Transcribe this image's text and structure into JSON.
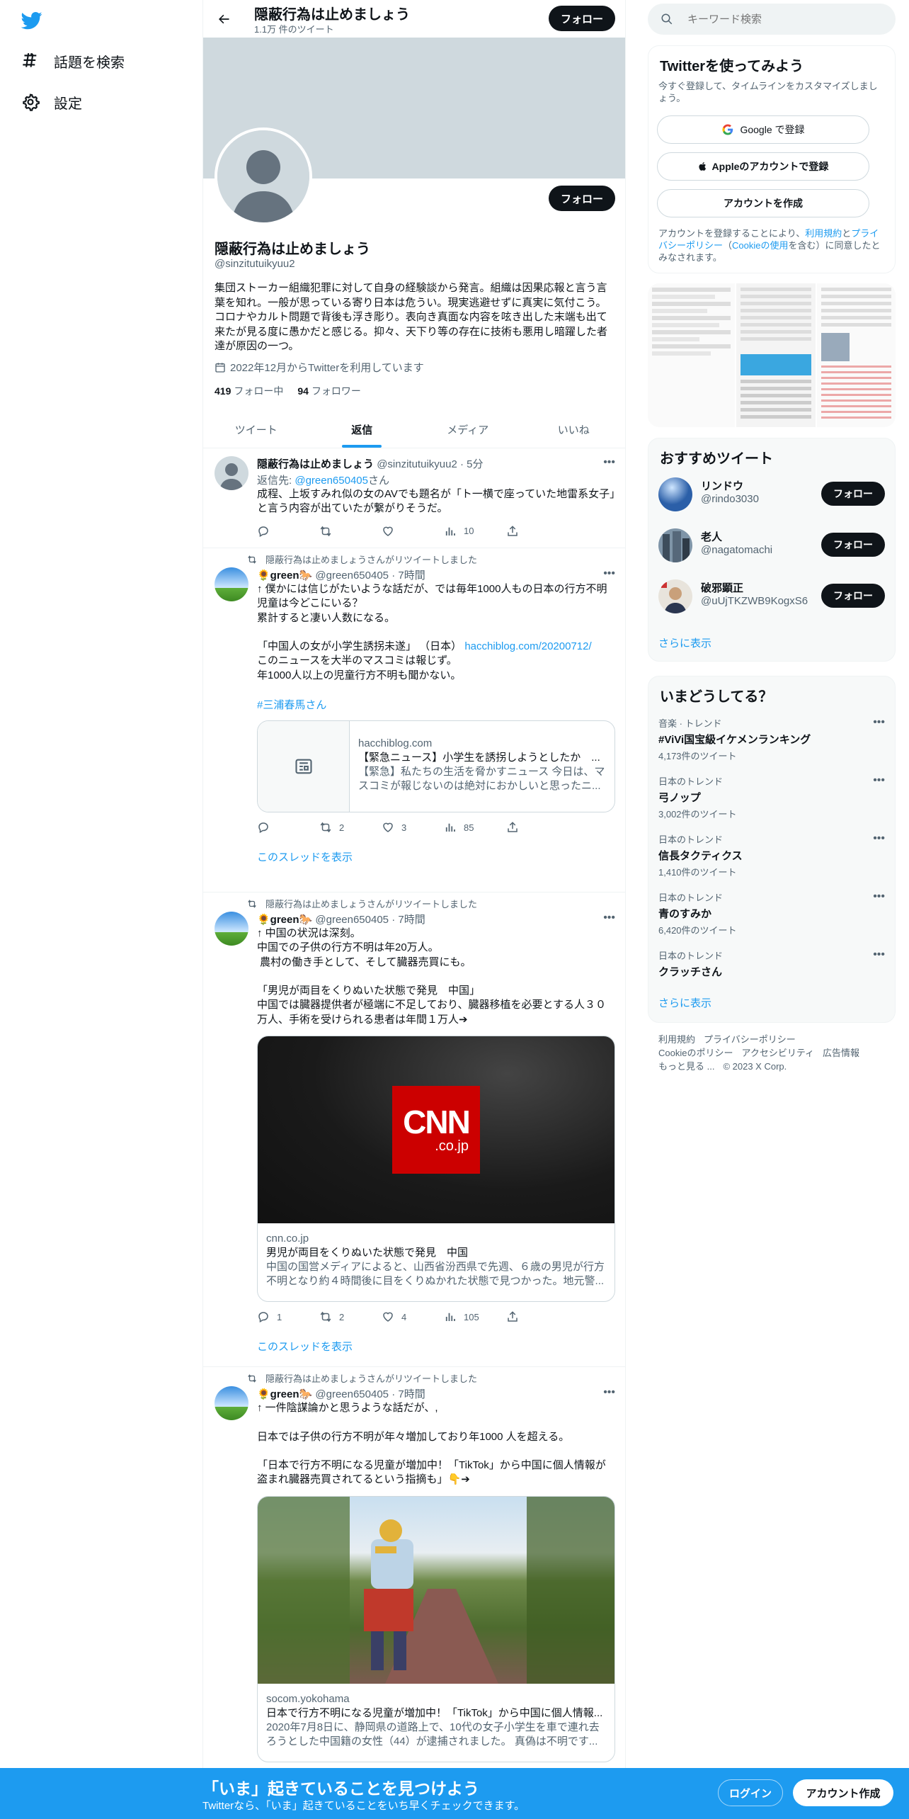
{
  "nav": {
    "items": [
      {
        "label": "話題を検索",
        "icon": "hashtag-icon"
      },
      {
        "label": "設定",
        "icon": "gear-icon"
      }
    ]
  },
  "header": {
    "title": "隠蔽行為は止めましょう",
    "subtitle": "1.1万 件のツイート",
    "follow_label": "フォロー"
  },
  "profile": {
    "name": "隠蔽行為は止めましょう",
    "handle": "@sinzitutuikyuu2",
    "bio": "集団ストーカー組織犯罪に対して自身の経験談から発言。組織は因果応報と言う言葉を知れ。一般が思っている寄り日本は危うい。現実逃避せずに真実に気付こう。コロナやカルト問題で背後も浮き彫り。表向き真面な内容を呟き出した末端も出て来たが見る度に愚かだと感じる。抑々、天下り等の存在に技術も悪用し暗躍した者達が原因の一つ。",
    "joined": "2022年12月からTwitterを利用しています",
    "following_count": "419",
    "following_label": "フォロー中",
    "followers_count": "94",
    "followers_label": "フォロワー",
    "follow_label": "フォロー"
  },
  "tabs": [
    {
      "label": "ツイート",
      "active": false
    },
    {
      "label": "返信",
      "active": true
    },
    {
      "label": "メディア",
      "active": false
    },
    {
      "label": "いいね",
      "active": false
    }
  ],
  "tweets": [
    {
      "name": "隠蔽行為は止めましょう",
      "meta": "@sinzitutuikyuu2 · 5分",
      "reply_to_prefix": "返信先: ",
      "reply_to_handle": "@green650405",
      "reply_to_suffix": "さん",
      "text": "成程、上坂すみれ似の女のAVでも題名が「ト一横で座っていた地雷系女子」と言う内容が出ていたが繋がりそうだ。",
      "reply": "",
      "retweet": "",
      "like": "",
      "views": "10"
    },
    {
      "retweeted_by": "隠蔽行為は止めましょうさんがリツイートしました",
      "name": "🌻green🐎",
      "meta": "@green650405 · 7時間",
      "text": "↑ 僕かには信じがたいような話だが、では毎年1000人もの日本の行方不明児童は今どこにいる？\n累計すると凄い人数になる。\n\n「中国人の女が小学生誘拐未遂」 （日本）",
      "link": "hacchiblog.com/20200712/",
      "text2": "このニュースを大半のマスコミは報じず。\n年1000人以上の児童行方不明も聞かない。",
      "hashtag": "#三浦春馬さん",
      "card_domain": "hacchiblog.com",
      "card_title": "【緊急ニュース】小学生を誘拐しようとしたか　...",
      "card_desc": "【緊急】私たちの生活を脅かすニュース 今日は、マスコミが報じないのは絶対におかしいと思ったニ...",
      "reply": "",
      "retweet": "2",
      "like": "3",
      "views": "85",
      "show_thread": "このスレッドを表示"
    },
    {
      "retweeted_by": "隠蔽行為は止めましょうさんがリツイートしました",
      "name": "🌻green🐎",
      "meta": "@green650405 · 7時間",
      "text": "↑ 中国の状況は深刻。\n中国での子供の行方不明は年20万人。\n 農村の働き手として、そして臓器売買にも。\n\n「男児が両目をくりぬいた状態で発見　中国」\n中国では臓器提供者が極端に不足しており、臓器移植を必要とする人３０万人、手術を受けられる患者は年間１万人➔",
      "card_logo_main": "CNN",
      "card_logo_sub": ".co.jp",
      "card_domain": "cnn.co.jp",
      "card_title": "男児が両目をくりぬいた状態で発見　中国",
      "card_desc": "中国の国営メディアによると、山西省汾西県で先週、６歳の男児が行方不明となり約４時間後に目をくりぬかれた状態で見つかった。地元警...",
      "reply": "1",
      "retweet": "2",
      "like": "4",
      "views": "105",
      "show_thread": "このスレッドを表示"
    },
    {
      "retweeted_by": "隠蔽行為は止めましょうさんがリツイートしました",
      "name": "🌻green🐎",
      "meta": "@green650405 · 7時間",
      "text": "↑ 一件陰謀論かと思うような話だが、,\n\n日本では子供の行方不明が年々増加しており年1000 人を超える。\n\n「日本で行方不明になる児童が増加中！「TikTok」から中国に個人情報が盗まれ臓器売買されてるという指摘も」👇➔",
      "card_domain": "socom.yokohama",
      "card_title": "日本で行方不明になる児童が増加中！「TikTok」から中国に個人情報...",
      "card_desc": "2020年7月8日に、静岡県の道路上で、10代の女子小学生を車で連れ去ろうとした中国籍の女性（44）が逮捕されました。 真偽は不明です..."
    }
  ],
  "search": {
    "placeholder": "キーワード検索"
  },
  "signup": {
    "title": "Twitterを使ってみよう",
    "subtitle": "今すぐ登録して、タイムラインをカスタマイズしましょう。",
    "google": "Google で登録",
    "apple": "Appleのアカウントで登録",
    "create": "アカウントを作成",
    "terms_pre": "アカウントを登録することにより、",
    "terms_link": "利用規約",
    "terms_mid": "と",
    "privacy_link": "プライバシーポリシー",
    "terms_paren_open": "（",
    "cookie_link": "Cookieの使用",
    "terms_post": "を含む）に同意したとみなされます。"
  },
  "recommended": {
    "title": "おすすめツイート",
    "users": [
      {
        "name": "リンドウ",
        "handle": "@rindo3030"
      },
      {
        "name": "老人",
        "handle": "@nagatomachi"
      },
      {
        "name": "破邪顕正",
        "handle": "@uUjTKZWB9KogxS6"
      }
    ],
    "follow_label": "フォロー",
    "more": "さらに表示"
  },
  "trends": {
    "title": "いまどうしてる？",
    "items": [
      {
        "context": "音楽 · トレンド",
        "name": "#ViVi国宝級イケメンランキング",
        "count": "4,173件のツイート"
      },
      {
        "context": "日本のトレンド",
        "name": "弓ノップ",
        "count": "3,002件のツイート"
      },
      {
        "context": "日本のトレンド",
        "name": "信長タクティクス",
        "count": "1,410件のツイート"
      },
      {
        "context": "日本のトレンド",
        "name": "青のすみか",
        "count": "6,420件のツイート"
      },
      {
        "context": "日本のトレンド",
        "name": "クラッチさん",
        "count": ""
      }
    ],
    "more": "さらに表示"
  },
  "footer": {
    "terms": "利用規約",
    "privacy": "プライバシーポリシー",
    "cookie": "Cookieのポリシー",
    "accessibility": "アクセシビリティ",
    "ads": "広告情報",
    "more": "もっと見る ...",
    "copyright": "© 2023 X Corp."
  },
  "bottombar": {
    "title": "「いま」起きていることを見つけよう",
    "subtitle": "Twitterなら、「いま」起きていることをいち早くチェックできます。",
    "login": "ログイン",
    "signup": "アカウント作成"
  },
  "colors": {
    "accent": "#1d9bf0",
    "text": "#0f1419",
    "muted": "#536471"
  }
}
